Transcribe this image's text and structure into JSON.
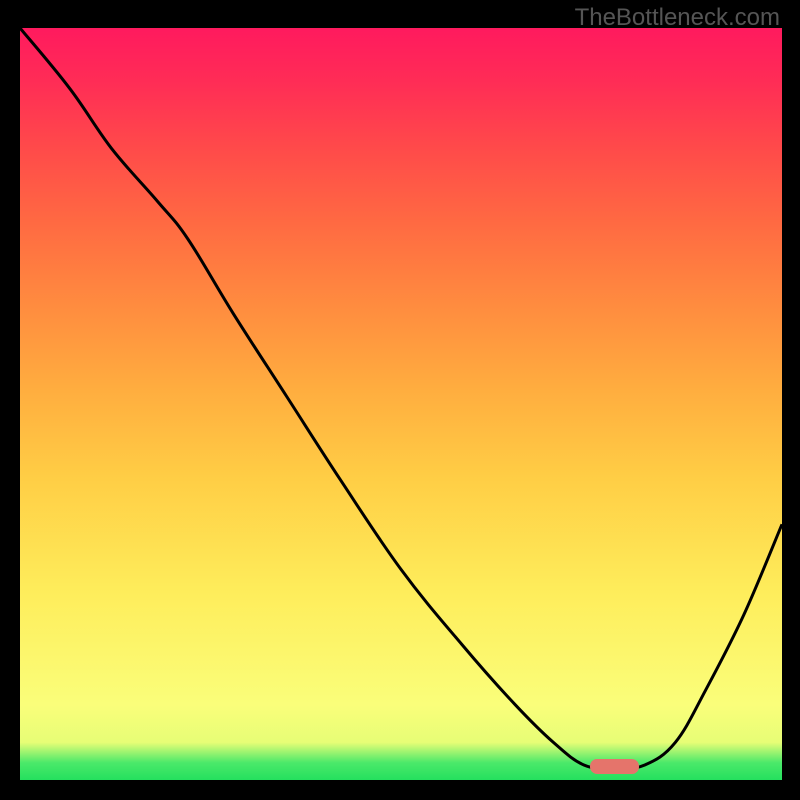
{
  "branding": {
    "watermark": "TheBottleneck.com"
  },
  "colors": {
    "background_frame": "#000000",
    "watermark_text": "#555555",
    "curve": "#000000",
    "marker": "#e5746b",
    "gradient_top": "#ff1a5e",
    "gradient_mid": "#ffce45",
    "gradient_low": "#fafe7a",
    "gradient_bottom": "#24e05e"
  },
  "chart_data": {
    "type": "line",
    "title": "",
    "xlabel": "",
    "ylabel": "",
    "xlim": [
      0,
      100
    ],
    "ylim": [
      0,
      100
    ],
    "grid": false,
    "comment": "Values are read as percentages of the plot area. y=0 is the bottom (green), y=100 is the top (red). The curve starts top-left, descends, flattens near the bottom around x≈74–82, then rises.",
    "series": [
      {
        "name": "curve",
        "x": [
          0,
          6.5,
          12,
          18,
          22,
          28,
          35,
          42,
          50,
          58,
          65,
          70,
          74,
          78,
          82,
          86,
          90,
          95,
          100
        ],
        "y": [
          100,
          92,
          84,
          77,
          72,
          62,
          51,
          40,
          28,
          18,
          10,
          5,
          2,
          1.5,
          2,
          5,
          12,
          22,
          34
        ]
      }
    ],
    "marker": {
      "shape": "pill",
      "x_center": 78,
      "y_center": 1.8,
      "width_pct": 6.5,
      "height_pct": 1.9
    }
  }
}
